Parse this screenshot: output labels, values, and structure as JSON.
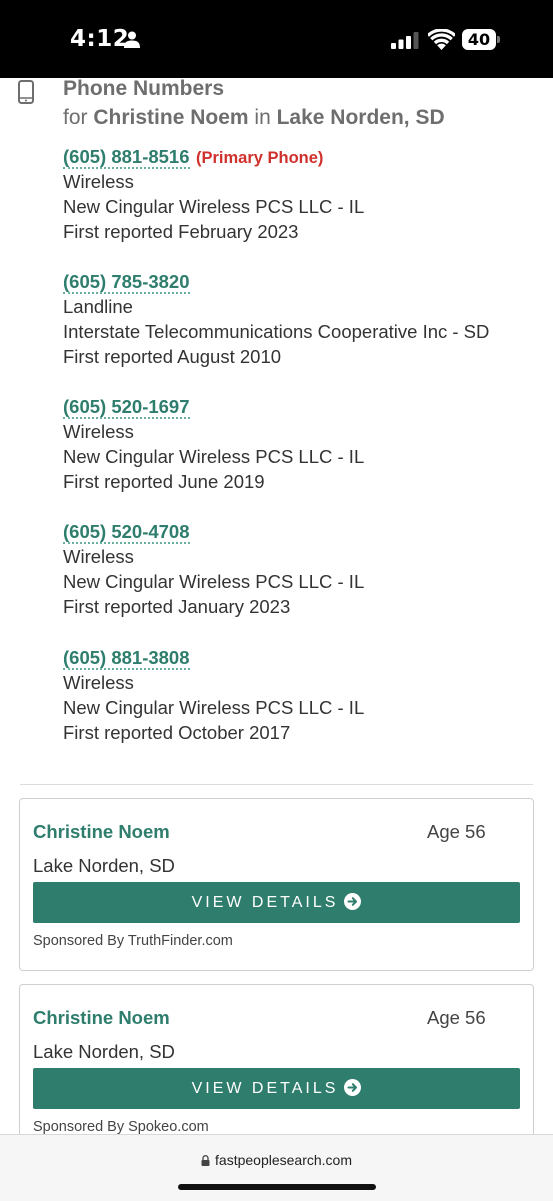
{
  "status_bar": {
    "time": "4:12",
    "battery": "40",
    "icons": [
      "person-icon",
      "signal-icon",
      "wifi-icon",
      "battery-icon"
    ]
  },
  "phone_section": {
    "title": "Phone Numbers",
    "subtitle_for": "for",
    "person_name": "Christine Noem",
    "subtitle_in": "in",
    "location": "Lake Norden, SD",
    "entries": [
      {
        "number": "(605) 881-8516",
        "tag": "(Primary Phone)",
        "type": "Wireless",
        "carrier": "New Cingular Wireless PCS LLC - IL",
        "reported": "First reported February 2023"
      },
      {
        "number": "(605) 785-3820",
        "tag": "",
        "type": "Landline",
        "carrier": "Interstate Telecommunications Cooperative Inc - SD",
        "reported": "First reported August 2010"
      },
      {
        "number": "(605) 520-1697",
        "tag": "",
        "type": "Wireless",
        "carrier": "New Cingular Wireless PCS LLC - IL",
        "reported": "First reported June 2019"
      },
      {
        "number": "(605) 520-4708",
        "tag": "",
        "type": "Wireless",
        "carrier": "New Cingular Wireless PCS LLC - IL",
        "reported": "First reported January 2023"
      },
      {
        "number": "(605) 881-3808",
        "tag": "",
        "type": "Wireless",
        "carrier": "New Cingular Wireless PCS LLC - IL",
        "reported": "First reported October 2017"
      }
    ]
  },
  "cards": [
    {
      "name": "Christine Noem",
      "age": "Age 56",
      "location": "Lake Norden, SD",
      "button": "VIEW DETAILS",
      "sponsored": "Sponsored By TruthFinder.com"
    },
    {
      "name": "Christine Noem",
      "age": "Age 56",
      "location": "Lake Norden, SD",
      "button": "VIEW DETAILS",
      "sponsored": "Sponsored By Spokeo.com"
    }
  ],
  "browser": {
    "url": "fastpeoplesearch.com"
  },
  "colors": {
    "accent_green": "#2f7d6c",
    "primary_red": "#d0312d"
  }
}
